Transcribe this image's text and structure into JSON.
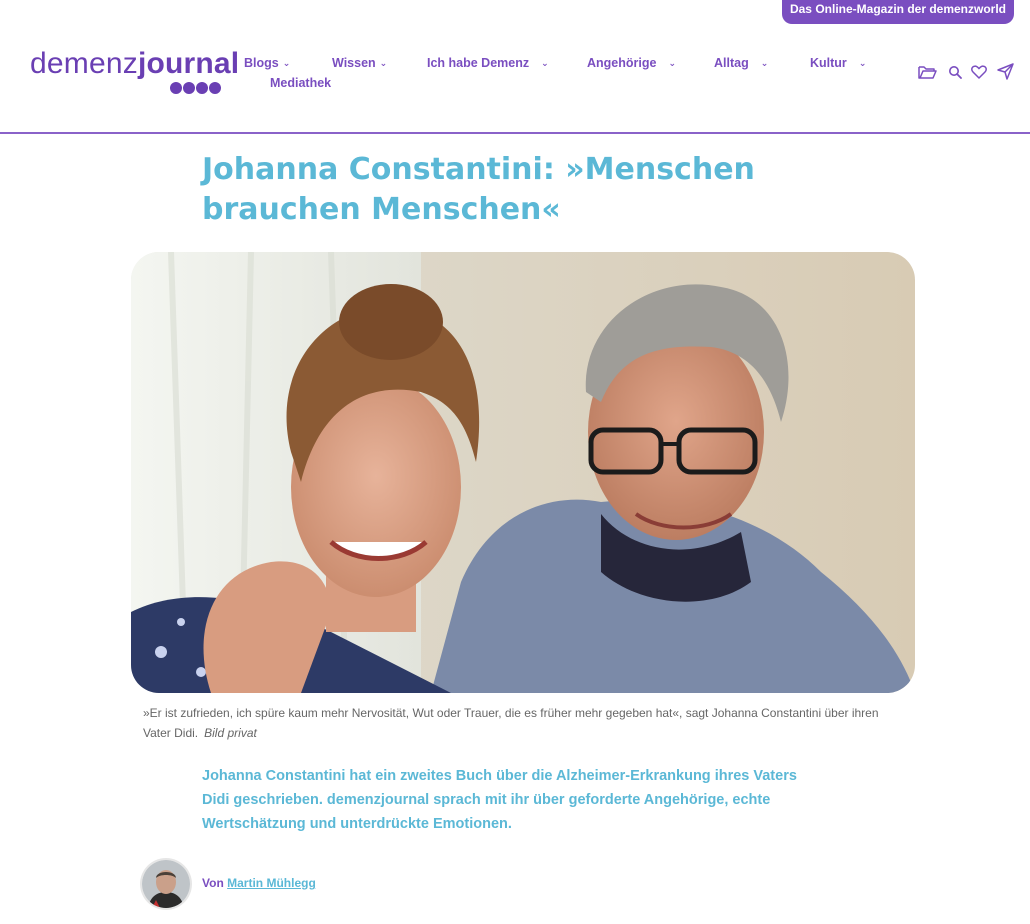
{
  "header": {
    "badge": "Das Online-Magazin der demenzworld",
    "logo_thin": "demenz",
    "logo_bold": "journal"
  },
  "nav": {
    "items": [
      {
        "label": "Blogs",
        "chevron": "chevron-down-icon"
      },
      {
        "label": "Wissen",
        "chevron": "chevron-down-icon"
      },
      {
        "label": "Ich habe Demenz",
        "chevron": "chevron-down-icon"
      },
      {
        "label": "Angehörige",
        "chevron": "chevron-down-icon"
      },
      {
        "label": "Alltag",
        "chevron": "chevron-down-icon"
      },
      {
        "label": "Kultur",
        "chevron": "chevron-down-icon"
      },
      {
        "label": "Mediathek"
      }
    ],
    "icons": [
      "folder-icon",
      "search-icon",
      "heart-icon",
      "send-icon"
    ]
  },
  "article": {
    "title": "Johanna Constantini: »Menschen brauchen Menschen«",
    "caption": "»Er ist zufrieden, ich spüre kaum mehr Nervosität, Wut oder Trauer, die es früher mehr gegeben hat«, sagt Johanna Constantini über ihren Vater Didi.",
    "credit": "Bild privat",
    "lead": "Johanna Constantini hat ein zweites Buch über die Alzheimer-Erkrankung ihres Vaters Didi geschrieben. demenzjournal sprach mit ihr über geforderte Angehörige, echte Wertschätzung und unterdrückte Emotionen.",
    "byline_prefix": "Von",
    "author": "Martin Mühlegg"
  },
  "colors": {
    "brand_purple": "#7a4ec0",
    "accent_cyan": "#5bb8d6",
    "divider": "#8a62c9"
  }
}
